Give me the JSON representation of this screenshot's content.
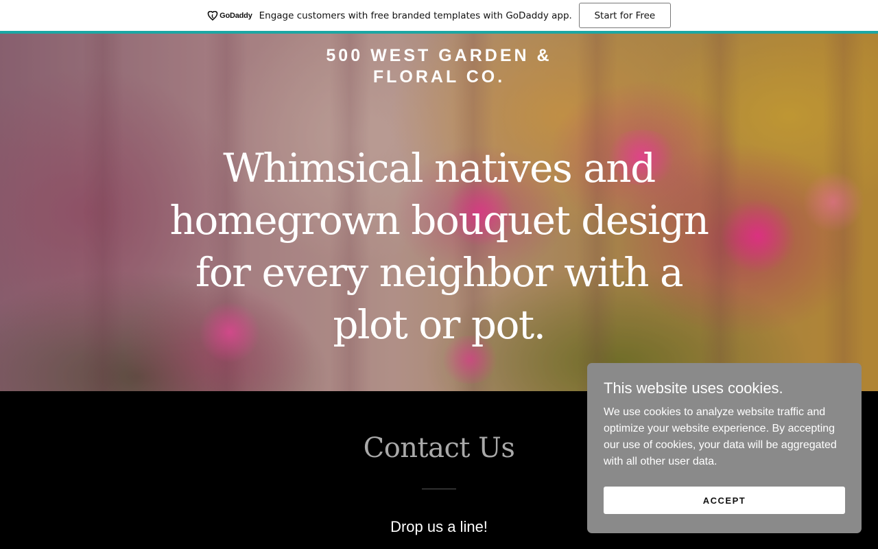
{
  "promo_bar": {
    "logo_text": "GoDaddy",
    "message": "Engage customers with free branded templates with GoDaddy app.",
    "cta_label": "Start for Free",
    "accent_color": "#1ba7a4"
  },
  "hero": {
    "site_title_lines": [
      "500 WEST GARDEN &",
      "FLORAL CO."
    ],
    "headline_lines": [
      "Whimsical natives and",
      "homegrown bouquet design",
      "for every neighbor with a",
      "plot or pot."
    ]
  },
  "contact": {
    "title": "Contact Us",
    "subtitle": "Drop us a line!"
  },
  "cookie_banner": {
    "title": "This website uses cookies.",
    "text": "We use cookies to analyze website traffic and optimize your website experience. By accepting our use of cookies, your data will be aggregated with all other user data.",
    "accept_label": "ACCEPT",
    "background_color": "#8a8a8a"
  }
}
